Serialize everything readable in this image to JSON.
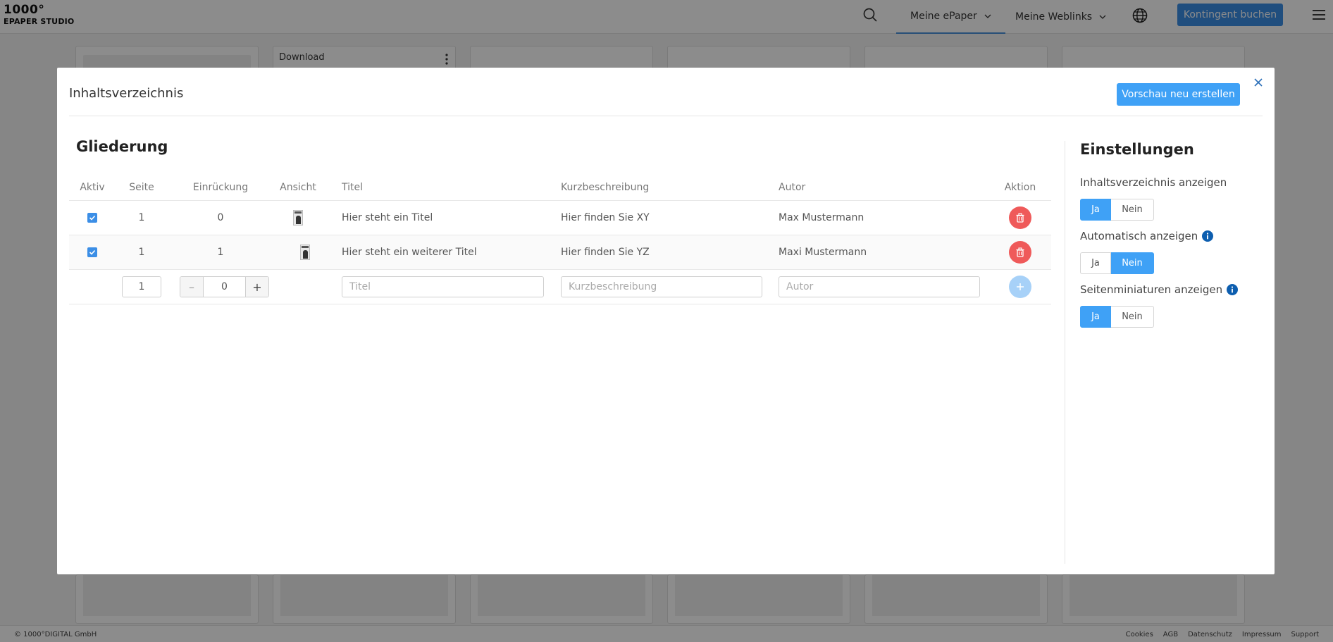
{
  "app": {
    "logo_line1": "1000°",
    "logo_line2": "EPAPER STUDIO"
  },
  "nav": {
    "items": [
      {
        "label": "Meine ePaper"
      },
      {
        "label": "Meine Weblinks"
      }
    ],
    "cta_label": "Kontingent buchen"
  },
  "background": {
    "card_label": "Download"
  },
  "footer": {
    "copyright": "© 1000°DIGITAL GmbH",
    "links": [
      "Cookies",
      "AGB",
      "Datenschutz",
      "Impressum",
      "Support"
    ]
  },
  "modal": {
    "title": "Inhaltsverzeichnis",
    "preview_button": "Vorschau neu erstellen",
    "outline": {
      "heading": "Gliederung",
      "columns": [
        "Aktiv",
        "Seite",
        "Einrückung",
        "Ansicht",
        "Titel",
        "Kurzbeschreibung",
        "Autor",
        "Aktion"
      ],
      "rows": [
        {
          "active": true,
          "page": "1",
          "indent": "0",
          "title": "Hier steht ein Titel",
          "description": "Hier finden Sie XY",
          "author": "Max Mustermann"
        },
        {
          "active": true,
          "page": "1",
          "indent": "1",
          "title": "Hier steht ein weiterer Titel",
          "description": "Hier finden Sie YZ",
          "author": "Maxi Mustermann"
        }
      ],
      "new_row": {
        "page_value": "1",
        "indent_value": "0",
        "title_placeholder": "Titel",
        "description_placeholder": "Kurzbeschreibung",
        "author_placeholder": "Autor"
      }
    },
    "settings": {
      "heading": "Einstellungen",
      "options": [
        {
          "label": "Inhaltsverzeichnis anzeigen",
          "yes": "Ja",
          "no": "Nein",
          "selected": "Ja",
          "info": false
        },
        {
          "label": "Automatisch anzeigen",
          "yes": "Ja",
          "no": "Nein",
          "selected": "Nein",
          "info": true
        },
        {
          "label": "Seitenminiaturen anzeigen",
          "yes": "Ja",
          "no": "Nein",
          "selected": "Ja",
          "info": true
        }
      ]
    }
  },
  "colors": {
    "primary": "#3fa1f6",
    "danger": "#ef5a5a",
    "info": "#0d5eaf"
  }
}
